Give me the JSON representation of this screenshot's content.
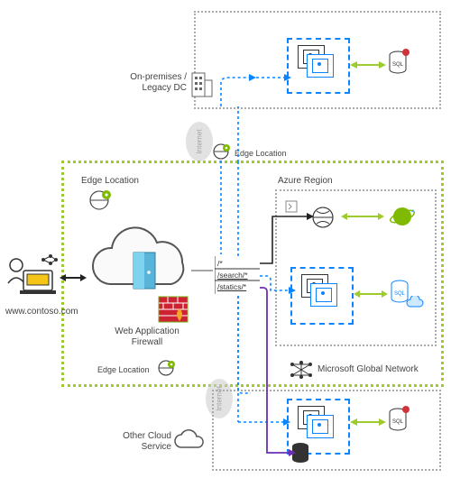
{
  "labels": {
    "site": "www.contoso.com",
    "onprem": "On-premises /\nLegacy DC",
    "edge_top": "Edge Location",
    "edge_left": "Edge Location",
    "edge_bottom": "Edge Location",
    "azure_region": "Azure Region",
    "waf": "Web Application\nFirewall",
    "mgn": "Microsoft Global Network",
    "other_cloud": "Other Cloud\nService",
    "internet": "Internet"
  },
  "routes": {
    "root": "/*",
    "search": "/search/*",
    "statics": "/statics/*"
  },
  "icons": {
    "user": "user-laptop",
    "building": "building",
    "cloud_door": "cloud-door",
    "firewall": "firewall",
    "globe_pin": "globe-pin",
    "vm": "virtual-machine",
    "sql": "sql-database",
    "webapp": "web-app-globe",
    "planet": "app-service",
    "storage": "storage-cylinder",
    "network": "network-mesh"
  },
  "colors": {
    "blue": "#0a84ff",
    "green": "#9ecb2f",
    "purple": "#6b2fb3",
    "gray": "#888",
    "darkgray": "#555",
    "black": "#222"
  }
}
